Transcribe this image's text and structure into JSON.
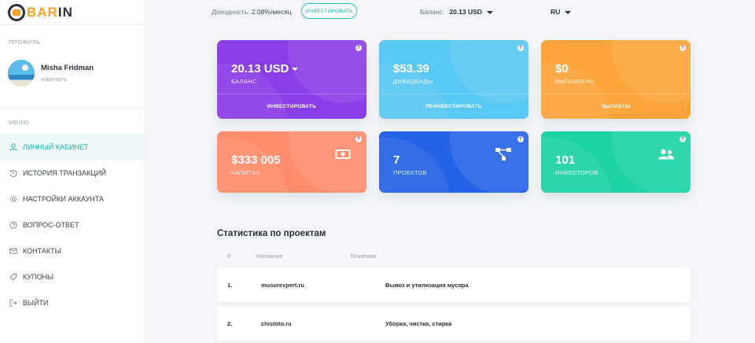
{
  "brand": {
    "prefix": "",
    "accent": "BAR",
    "suffix": "IN"
  },
  "topbar": {
    "yield_label": "Доходность:",
    "yield_value": "2.08%/месяц",
    "invest_button": "ИНВЕСТИРОВАТЬ",
    "balance_label": "Баланс:",
    "balance_value": "20.13 USD",
    "language": "RU"
  },
  "sidebar": {
    "profile_label": "ПРОФИЛЬ",
    "user_name": "Misha Fridman",
    "edit_label": "изменить",
    "menu_label": "МЕНЮ",
    "items": [
      {
        "label": "ЛИЧНЫЙ КАБИНЕТ",
        "icon": "user-icon",
        "active": true
      },
      {
        "label": "ИСТОРИЯ ТРАНЗАКЦИЙ",
        "icon": "history-icon",
        "active": false
      },
      {
        "label": "НАСТРОЙКИ АККАУНТА",
        "icon": "gear-icon",
        "active": false
      },
      {
        "label": "ВОПРОС-ОТВЕТ",
        "icon": "question-icon",
        "active": false
      },
      {
        "label": "КОНТАКТЫ",
        "icon": "mail-icon",
        "active": false
      },
      {
        "label": "КУПОНЫ",
        "icon": "tag-icon",
        "active": false
      },
      {
        "label": "ВЫЙТИ",
        "icon": "logout-icon",
        "active": false
      }
    ]
  },
  "cards": [
    {
      "value": "20.13 USD",
      "label": "БАЛАНС",
      "action": "ИНВЕСТИРОВАТЬ",
      "color": "#8a3ee8"
    },
    {
      "value": "$53.39",
      "label": "ДИВИДЕНДЫ",
      "action": "РЕИНВЕСТИРОВАТЬ",
      "color": "#58c8f4"
    },
    {
      "value": "$0",
      "label": "ВЫПЛАЧЕНО",
      "action": "ВЫПЛАТЫ",
      "color": "#fda43b"
    },
    {
      "value": "$333 005",
      "label": "КАПИТАЛ",
      "icon": "money-icon",
      "color": "#ff8c6c"
    },
    {
      "value": "7",
      "label": "ПРОЕКТОВ",
      "icon": "network-icon",
      "color": "#2563e6"
    },
    {
      "value": "101",
      "label": "ИНВЕСТОРОВ",
      "icon": "users-icon",
      "color": "#1dd3a4"
    }
  ],
  "stats": {
    "title": "Статистика по проектам",
    "columns": [
      "#",
      "Название",
      "Тематика"
    ],
    "rows": [
      {
        "num": "1.",
        "name": "musorexpert.ru",
        "topic": "Вывоз и утилизация мусора"
      },
      {
        "num": "2.",
        "name": "chistoto.ru",
        "topic": "Уборка, чистка, стирка"
      }
    ]
  },
  "help_glyph": "?"
}
